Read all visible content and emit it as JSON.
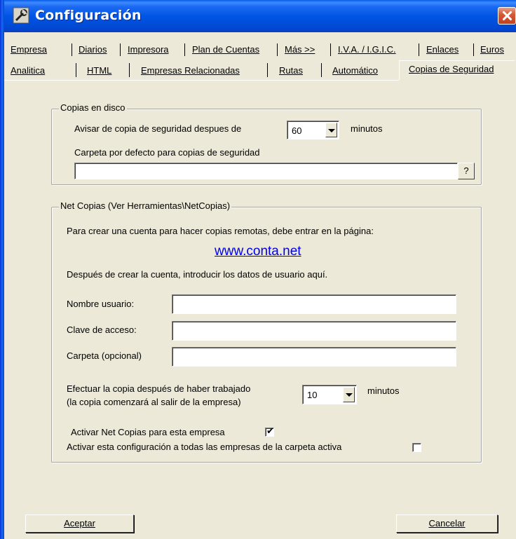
{
  "window": {
    "title": "Configuración"
  },
  "tabs": {
    "row1": [
      "Empresa",
      "Diarios",
      "Impresora",
      "Plan de Cuentas",
      "Más >>",
      "I.V.A. / I.G.I.C.",
      "Enlaces",
      "Euros"
    ],
    "row2": [
      "Analitica",
      "HTML",
      "Empresas Relacionadas",
      "Rutas",
      "Automático",
      "Copias de Seguridad"
    ],
    "active": "Copias de Seguridad"
  },
  "disk_copies": {
    "title": "Copias en disco",
    "warn_label": "Avisar de copia de seguridad despues de",
    "warn_value": "60",
    "warn_unit": "minutos",
    "folder_label": "Carpeta por defecto para copias de seguridad",
    "folder_value": "",
    "browse_label": "?"
  },
  "net_copies": {
    "title": "Net Copias (Ver Herramientas\\NetCopias)",
    "intro": "Para crear una cuenta para hacer copias remotas, debe entrar en la página:",
    "link": "www.conta.net",
    "after_text": "Después de crear la cuenta, introducir los datos de usuario aquí.",
    "user_label": "Nombre usuario:",
    "user_value": "",
    "password_label": "Clave de acceso:",
    "password_value": "",
    "folder_label": "Carpeta (opcional)",
    "folder_value": "",
    "delay_label_1": "Efectuar la copia después de haber trabajado",
    "delay_label_2": "(la copia comenzará al salir de la empresa)",
    "delay_value": "10",
    "delay_unit": "minutos",
    "activate_label": "Activar Net Copias para esta empresa",
    "activate_checked": true,
    "apply_all_label": "Activar esta configuración a todas las empresas de la carpeta activa",
    "apply_all_checked": false
  },
  "buttons": {
    "accept": "Aceptar",
    "cancel": "Cancelar"
  }
}
